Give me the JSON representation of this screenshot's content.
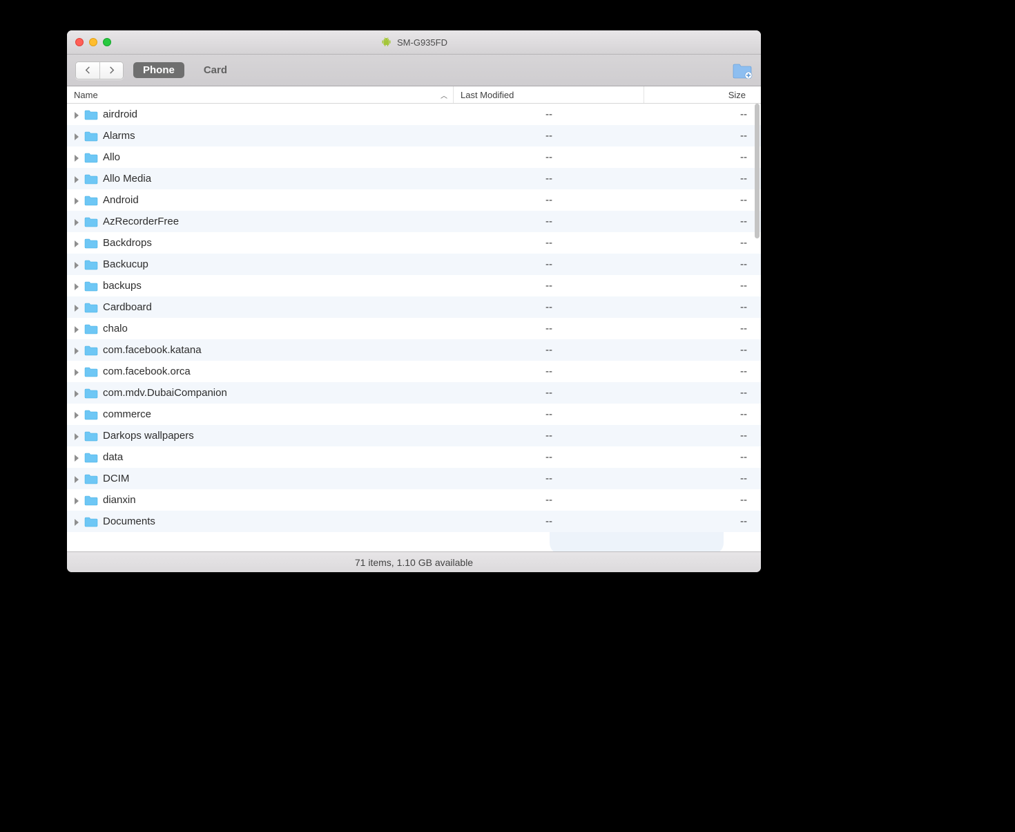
{
  "window": {
    "title": "SM-G935FD"
  },
  "toolbar": {
    "tabs": [
      {
        "label": "Phone",
        "active": true
      },
      {
        "label": "Card",
        "active": false
      }
    ]
  },
  "columns": {
    "name": "Name",
    "last_modified": "Last Modified",
    "size": "Size"
  },
  "rows": [
    {
      "name": "airdroid",
      "last_modified": "--",
      "size": "--"
    },
    {
      "name": "Alarms",
      "last_modified": "--",
      "size": "--"
    },
    {
      "name": "Allo",
      "last_modified": "--",
      "size": "--"
    },
    {
      "name": "Allo Media",
      "last_modified": "--",
      "size": "--"
    },
    {
      "name": "Android",
      "last_modified": "--",
      "size": "--"
    },
    {
      "name": "AzRecorderFree",
      "last_modified": "--",
      "size": "--"
    },
    {
      "name": "Backdrops",
      "last_modified": "--",
      "size": "--"
    },
    {
      "name": "Backucup",
      "last_modified": "--",
      "size": "--"
    },
    {
      "name": "backups",
      "last_modified": "--",
      "size": "--"
    },
    {
      "name": "Cardboard",
      "last_modified": "--",
      "size": "--"
    },
    {
      "name": "chalo",
      "last_modified": "--",
      "size": "--"
    },
    {
      "name": "com.facebook.katana",
      "last_modified": "--",
      "size": "--"
    },
    {
      "name": "com.facebook.orca",
      "last_modified": "--",
      "size": "--"
    },
    {
      "name": "com.mdv.DubaiCompanion",
      "last_modified": "--",
      "size": "--"
    },
    {
      "name": "commerce",
      "last_modified": "--",
      "size": "--"
    },
    {
      "name": "Darkops wallpapers",
      "last_modified": "--",
      "size": "--"
    },
    {
      "name": "data",
      "last_modified": "--",
      "size": "--"
    },
    {
      "name": "DCIM",
      "last_modified": "--",
      "size": "--"
    },
    {
      "name": "dianxin",
      "last_modified": "--",
      "size": "--"
    },
    {
      "name": "Documents",
      "last_modified": "--",
      "size": "--"
    }
  ],
  "status": {
    "text": "71 items, 1.10 GB available"
  }
}
